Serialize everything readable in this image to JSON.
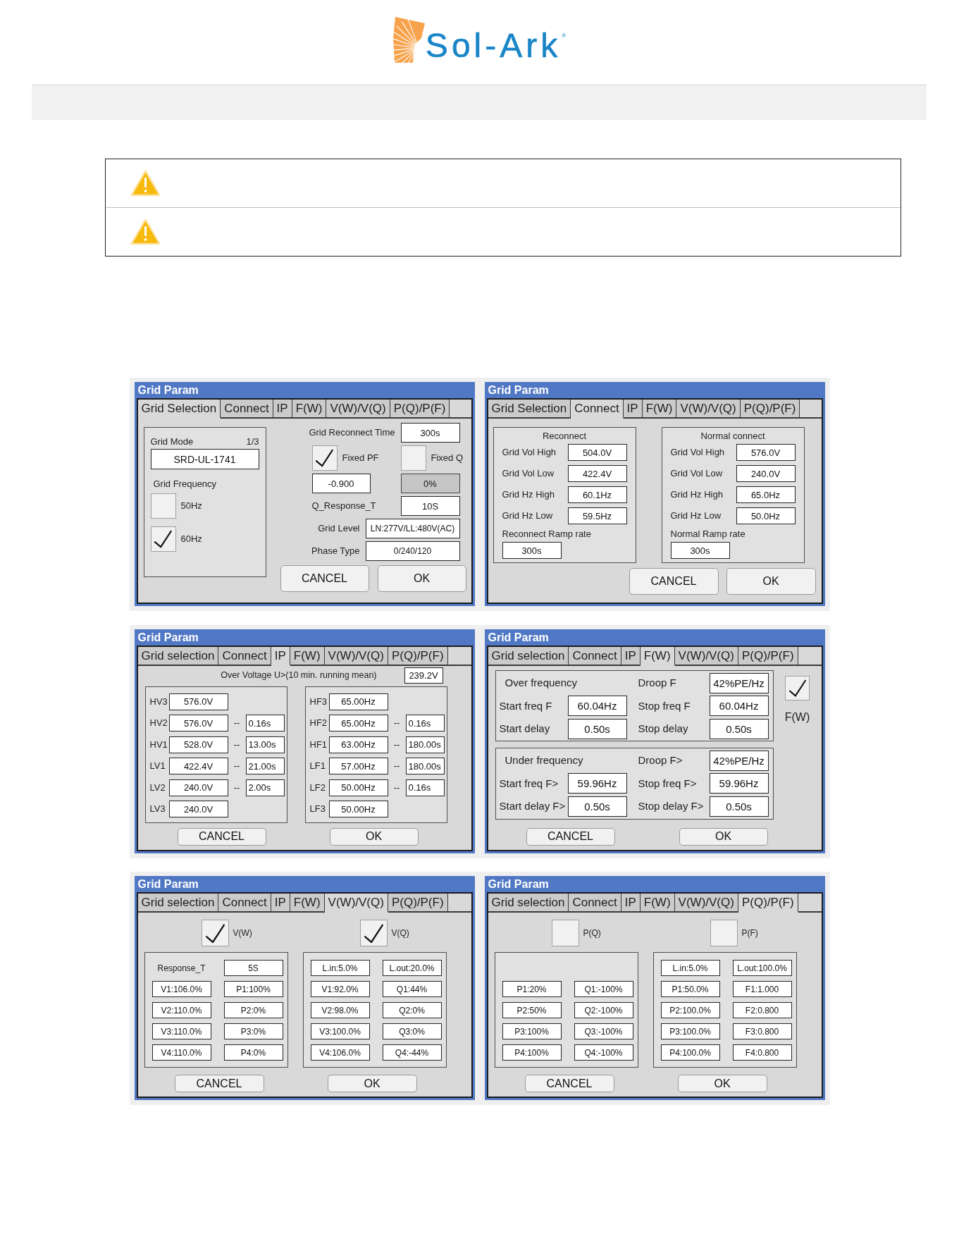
{
  "logo": {
    "text": "Sol-Ark",
    "mark": "®"
  },
  "notices": [
    {
      "kind": "warning"
    },
    {
      "kind": "warning"
    }
  ],
  "panels": [
    {
      "kind": "grid_selection",
      "title": "Grid Param",
      "tabs": [
        {
          "label": "Grid Selection",
          "selected": true
        },
        {
          "label": "Connect",
          "selected": false
        },
        {
          "label": "IP",
          "selected": false
        },
        {
          "label": "F(W)",
          "selected": false
        },
        {
          "label": "V(W)/V(Q)",
          "selected": false
        },
        {
          "label": "P(Q)/P(F)",
          "selected": false
        }
      ],
      "grid_mode": {
        "label": "Grid Mode",
        "page": "1/3",
        "value": "SRD-UL-1741"
      },
      "grid_frequency": {
        "label": "Grid Frequency",
        "options": [
          {
            "label": "50Hz",
            "checked": false
          },
          {
            "label": "60Hz",
            "checked": true
          }
        ]
      },
      "reconnect_time": {
        "label": "Grid Reconnect Time",
        "value": "300s"
      },
      "fixed_modes": [
        {
          "label": "Fixed PF",
          "checked": true,
          "value": "-0.900",
          "disabled": false
        },
        {
          "label": "Fixed Q",
          "checked": false,
          "value": "0%",
          "disabled": true
        }
      ],
      "q_response": {
        "label": "Q_Response_T",
        "value": "10S"
      },
      "settings": [
        {
          "label": "Grid Level",
          "value": "LN:277V/LL:480V(AC)"
        },
        {
          "label": "Phase Type",
          "value": "0/240/120"
        }
      ],
      "buttons": [
        "CANCEL",
        "OK"
      ]
    },
    {
      "kind": "connect",
      "title": "Grid Param",
      "tabs": [
        {
          "label": "Grid Selection",
          "selected": false
        },
        {
          "label": "Connect",
          "selected": true
        },
        {
          "label": "IP",
          "selected": false
        },
        {
          "label": "F(W)",
          "selected": false
        },
        {
          "label": "V(W)/V(Q)",
          "selected": false
        },
        {
          "label": "P(Q)/P(F)",
          "selected": false
        }
      ],
      "groups": [
        {
          "title": "Reconnect",
          "rows": [
            {
              "label": "Grid Vol High",
              "value": "504.0V"
            },
            {
              "label": "Grid Vol Low",
              "value": "422.4V"
            },
            {
              "label": "Grid Hz High",
              "value": "60.1Hz"
            },
            {
              "label": "Grid Hz Low",
              "value": "59.5Hz"
            }
          ],
          "ramp": {
            "label": "Reconnect Ramp rate",
            "value": "300s"
          }
        },
        {
          "title": "Normal connect",
          "rows": [
            {
              "label": "Grid Vol High",
              "value": "576.0V"
            },
            {
              "label": "Grid Vol Low",
              "value": "240.0V"
            },
            {
              "label": "Grid Hz High",
              "value": "65.0Hz"
            },
            {
              "label": "Grid Hz Low",
              "value": "50.0Hz"
            }
          ],
          "ramp": {
            "label": "Normal Ramp rate",
            "value": "300s"
          }
        }
      ],
      "buttons": [
        "CANCEL",
        "OK"
      ]
    },
    {
      "kind": "ip",
      "title": "Grid Param",
      "tabs": [
        {
          "label": "Grid selection",
          "selected": false
        },
        {
          "label": "Connect",
          "selected": false
        },
        {
          "label": "IP",
          "selected": true
        },
        {
          "label": "F(W)",
          "selected": false
        },
        {
          "label": "V(W)/V(Q)",
          "selected": false
        },
        {
          "label": "P(Q)/P(F)",
          "selected": false
        }
      ],
      "over_voltage": {
        "label": "Over Voltage U>(10 min. running mean)",
        "value": "239.2V"
      },
      "groups": [
        {
          "rows": [
            {
              "label": "HV3",
              "value": "576.0V"
            },
            {
              "label": "HV2",
              "value": "576.0V",
              "dash": "--",
              "time": "0.16s"
            },
            {
              "label": "HV1",
              "value": "528.0V",
              "dash": "--",
              "time": "13.00s"
            },
            {
              "label": "LV1",
              "value": "422.4V",
              "dash": "--",
              "time": "21.00s"
            },
            {
              "label": "LV2",
              "value": "240.0V",
              "dash": "--",
              "time": "2.00s"
            },
            {
              "label": "LV3",
              "value": "240.0V"
            }
          ]
        },
        {
          "rows": [
            {
              "label": "HF3",
              "value": "65.00Hz"
            },
            {
              "label": "HF2",
              "value": "65.00Hz",
              "dash": "--",
              "time": "0.16s"
            },
            {
              "label": "HF1",
              "value": "63.00Hz",
              "dash": "--",
              "time": "180.00s"
            },
            {
              "label": "LF1",
              "value": "57.00Hz",
              "dash": "--",
              "time": "180.00s"
            },
            {
              "label": "LF2",
              "value": "50.00Hz",
              "dash": "--",
              "time": "0.16s"
            },
            {
              "label": "LF3",
              "value": "50.00Hz"
            }
          ]
        }
      ],
      "buttons": [
        "CANCEL",
        "OK"
      ]
    },
    {
      "kind": "frequency_watt",
      "title": "Grid Param",
      "tabs": [
        {
          "label": "Grid selection",
          "selected": false
        },
        {
          "label": "Connect",
          "selected": false
        },
        {
          "label": "IP",
          "selected": false
        },
        {
          "label": "F(W)",
          "selected": true
        },
        {
          "label": "V(W)/V(Q)",
          "selected": false
        },
        {
          "label": "P(Q)/P(F)",
          "selected": false
        }
      ],
      "groups": [
        {
          "title": "Over frequency",
          "droop": {
            "label": "Droop F",
            "value": "42%PE/Hz"
          },
          "rows": [
            {
              "label": "Start freq F",
              "value": "60.04Hz"
            },
            {
              "label": "Stop freq F",
              "value": "60.04Hz"
            },
            {
              "label": "Start delay",
              "value": "0.50s"
            },
            {
              "label": "Stop delay",
              "value": "0.50s"
            }
          ]
        },
        {
          "title": "Under frequency",
          "droop": {
            "label": "Droop F>",
            "value": "42%PE/Hz"
          },
          "rows": [
            {
              "label": "Start freq F>",
              "value": "59.96Hz"
            },
            {
              "label": "Stop freq F>",
              "value": "59.96Hz"
            },
            {
              "label": "Start delay F>",
              "value": "0.50s"
            },
            {
              "label": "Stop delay F>",
              "value": "0.50s"
            }
          ]
        }
      ],
      "toggle": {
        "label": "F(W)",
        "checked": true
      },
      "buttons": [
        "CANCEL",
        "OK"
      ]
    },
    {
      "kind": "curves",
      "title": "Grid Param",
      "tabs": [
        {
          "label": "Grid selection",
          "selected": false
        },
        {
          "label": "Connect",
          "selected": false
        },
        {
          "label": "IP",
          "selected": false
        },
        {
          "label": "F(W)",
          "selected": false
        },
        {
          "label": "V(W)/V(Q)",
          "selected": true
        },
        {
          "label": "P(Q)/P(F)",
          "selected": false
        }
      ],
      "toggles": [
        {
          "label": "V(W)",
          "checked": true
        },
        {
          "label": "V(Q)",
          "checked": true
        }
      ],
      "groups": [
        {
          "cells": [
            {
              "kind": "label",
              "text": "Response_T"
            },
            {
              "kind": "field",
              "text": "5S"
            },
            {
              "kind": "field",
              "text": "V1:106.0%"
            },
            {
              "kind": "field",
              "text": "P1:100%"
            },
            {
              "kind": "field",
              "text": "V2:110.0%"
            },
            {
              "kind": "field",
              "text": "P2:0%"
            },
            {
              "kind": "field",
              "text": "V3:110.0%"
            },
            {
              "kind": "field",
              "text": "P3:0%"
            },
            {
              "kind": "field",
              "text": "V4:110.0%"
            },
            {
              "kind": "field",
              "text": "P4:0%"
            }
          ]
        },
        {
          "cells": [
            {
              "kind": "field",
              "text": "L.in:5.0%"
            },
            {
              "kind": "field",
              "text": "L.out:20.0%"
            },
            {
              "kind": "field",
              "text": "V1:92.0%"
            },
            {
              "kind": "field",
              "text": "Q1:44%"
            },
            {
              "kind": "field",
              "text": "V2:98.0%"
            },
            {
              "kind": "field",
              "text": "Q2:0%"
            },
            {
              "kind": "field",
              "text": "V3:100.0%"
            },
            {
              "kind": "field",
              "text": "Q3:0%"
            },
            {
              "kind": "field",
              "text": "V4:106.0%"
            },
            {
              "kind": "field",
              "text": "Q4:-44%"
            }
          ]
        }
      ],
      "buttons": [
        "CANCEL",
        "OK"
      ]
    },
    {
      "kind": "curves",
      "title": "Grid Param",
      "tabs": [
        {
          "label": "Grid selection",
          "selected": false
        },
        {
          "label": "Connect",
          "selected": false
        },
        {
          "label": "IP",
          "selected": false
        },
        {
          "label": "F(W)",
          "selected": false
        },
        {
          "label": "V(W)/V(Q)",
          "selected": false
        },
        {
          "label": "P(Q)/P(F)",
          "selected": true
        }
      ],
      "toggles": [
        {
          "label": "P(Q)",
          "checked": false
        },
        {
          "label": "P(F)",
          "checked": false
        }
      ],
      "groups": [
        {
          "cells": [
            {
              "kind": "field",
              "text": "P1:20%"
            },
            {
              "kind": "field",
              "text": "Q1:-100%"
            },
            {
              "kind": "field",
              "text": "P2:50%"
            },
            {
              "kind": "field",
              "text": "Q2:-100%"
            },
            {
              "kind": "field",
              "text": "P3:100%"
            },
            {
              "kind": "field",
              "text": "Q3:-100%"
            },
            {
              "kind": "field",
              "text": "P4:100%"
            },
            {
              "kind": "field",
              "text": "Q4:-100%"
            }
          ]
        },
        {
          "cells": [
            {
              "kind": "field",
              "text": "L.in:5.0%"
            },
            {
              "kind": "field",
              "text": "L.out:100.0%"
            },
            {
              "kind": "field",
              "text": "P1:50.0%"
            },
            {
              "kind": "field",
              "text": "F1:1.000"
            },
            {
              "kind": "field",
              "text": "P2:100.0%"
            },
            {
              "kind": "field",
              "text": "F2:0.800"
            },
            {
              "kind": "field",
              "text": "P3:100.0%"
            },
            {
              "kind": "field",
              "text": "F3:0.800"
            },
            {
              "kind": "field",
              "text": "P4:100.0%"
            },
            {
              "kind": "field",
              "text": "F4:0.800"
            }
          ]
        }
      ],
      "buttons": [
        "CANCEL",
        "OK"
      ]
    }
  ]
}
